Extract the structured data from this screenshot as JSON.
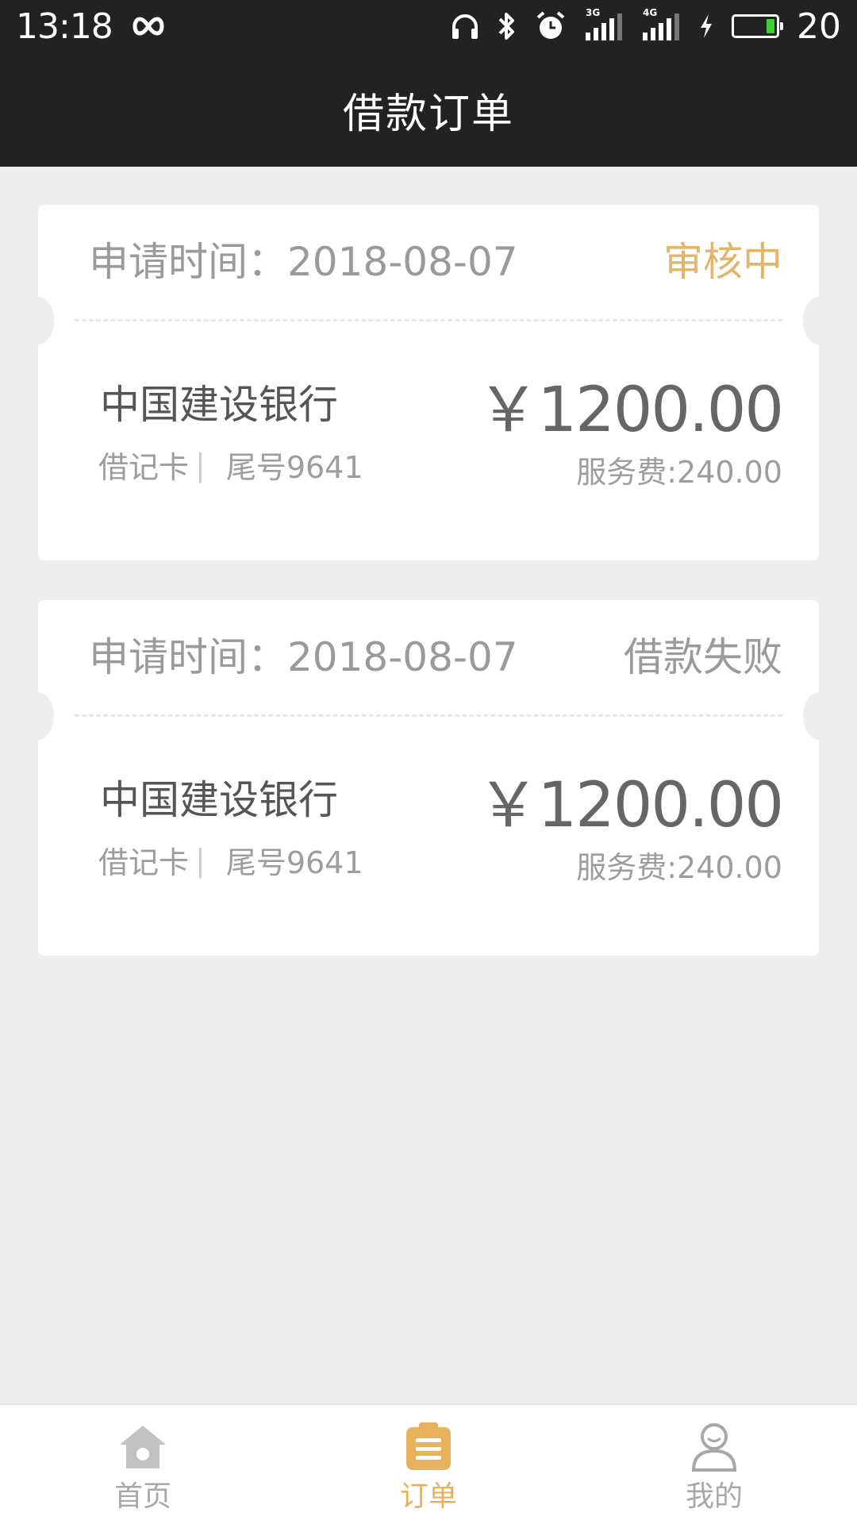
{
  "status_bar": {
    "time": "13:18",
    "network_3g": "3G",
    "network_4g": "4G",
    "battery_percent": "20",
    "battery_level": 0.2
  },
  "header": {
    "title": "借款订单"
  },
  "orders": [
    {
      "apply_time": "申请时间：2018-08-07",
      "status": "审核中",
      "status_color": "#e2b66a",
      "bank_name": "中国建设银行",
      "card_type": "借记卡",
      "card_sep": "|",
      "card_tail": "尾号9641",
      "amount": "￥1200.00",
      "fee": "服务费:240.00"
    },
    {
      "apply_time": "申请时间：2018-08-07",
      "status": "借款失败",
      "status_color": "#9a9a9a",
      "bank_name": "中国建设银行",
      "card_type": "借记卡",
      "card_sep": "|",
      "card_tail": "尾号9641",
      "amount": "￥1200.00",
      "fee": "服务费:240.00"
    }
  ],
  "tab_bar": {
    "items": [
      {
        "label": "首页",
        "icon": "home-icon",
        "active": false
      },
      {
        "label": "订单",
        "icon": "order-list-icon",
        "active": true
      },
      {
        "label": "我的",
        "icon": "user-profile-icon",
        "active": false
      }
    ],
    "active_color": "#e8b25c",
    "inactive_color": "#a8a8a8"
  }
}
